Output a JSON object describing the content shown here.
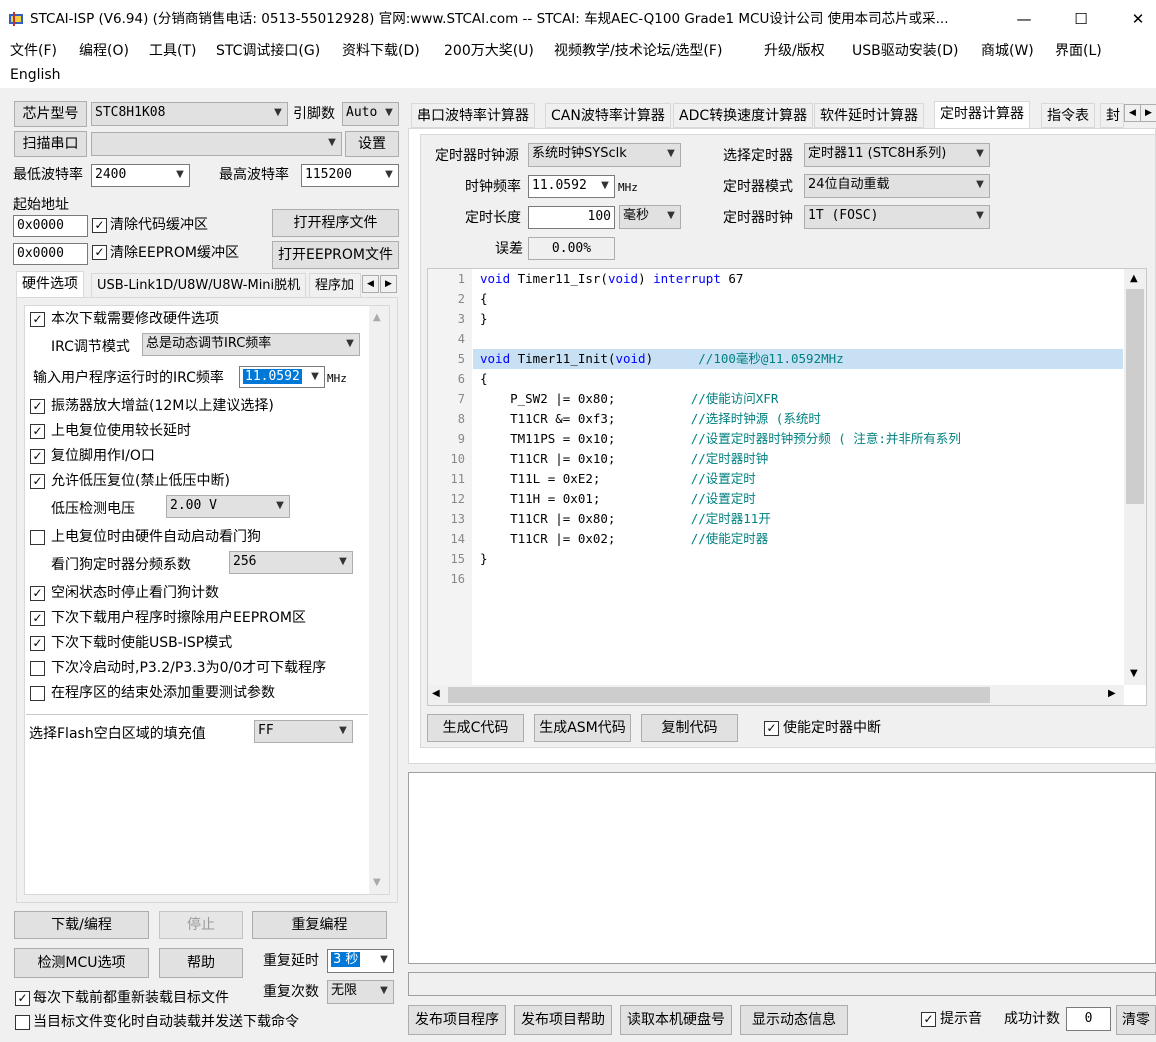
{
  "window": {
    "title": "STCAI-ISP (V6.94) (分销商销售电话: 0513-55012928) 官网:www.STCAI.com  -- STCAI: 车规AEC-Q100 Grade1 MCU设计公司 使用本司芯片或采...",
    "minimize": "—",
    "maximize": "☐",
    "close": "✕"
  },
  "menu": {
    "items": [
      "文件(F)",
      "编程(O)",
      "工具(T)",
      "STC调试接口(G)",
      "资料下载(D)",
      "200万大奖(U)",
      "视频教学/技术论坛/选型(F)",
      "升级/版权",
      "USB驱动安装(D)",
      "商城(W)",
      "界面(L)"
    ],
    "second_row": "English"
  },
  "left": {
    "chip_type_btn": "芯片型号",
    "chip_type_value": "STC8H1K08",
    "pin_label": "引脚数",
    "pin_value": "Auto",
    "scan_port_btn": "扫描串口",
    "port_value": "",
    "settings_btn": "设置",
    "min_baud_label": "最低波特率",
    "min_baud_value": "2400",
    "max_baud_label": "最高波特率",
    "max_baud_value": "115200",
    "start_addr_label": "起始地址",
    "addr1": "0x0000",
    "clear_code_label": "清除代码缓冲区",
    "open_prog_btn": "打开程序文件",
    "addr2": "0x0000",
    "clear_eeprom_label": "清除EEPROM缓冲区",
    "open_eeprom_btn": "打开EEPROM文件",
    "tabs": [
      "硬件选项",
      "USB-Link1D/U8W/U8W-Mini脱机",
      "程序加"
    ],
    "hw": {
      "need_modify": "本次下载需要修改硬件选项",
      "irc_mode_label": "IRC调节模式",
      "irc_mode_value": "总是动态调节IRC频率",
      "irc_freq_label": "输入用户程序运行时的IRC频率",
      "irc_freq_value": "11.0592",
      "irc_freq_unit": "MHz",
      "amp": "振荡器放大增益(12M以上建议选择)",
      "long_delay": "上电复位使用较长延时",
      "reset_io": "复位脚用作I/O口",
      "low_volt_reset": "允许低压复位(禁止低压中断)",
      "low_volt_label": "低压检测电压",
      "low_volt_value": "2.00 V",
      "watchdog": "上电复位时由硬件自动启动看门狗",
      "wd_div_label": "看门狗定时器分频系数",
      "wd_div_value": "256",
      "idle_stop_wd": "空闲状态时停止看门狗计数",
      "erase_eeprom": "下次下载用户程序时擦除用户EEPROM区",
      "usb_isp": "下次下载时使能USB-ISP模式",
      "cold_boot": "下次冷启动时,P3.2/P3.3为0/0才可下载程序",
      "add_params": "在程序区的结束处添加重要测试参数",
      "fill_label": "选择Flash空白区域的填充值",
      "fill_value": "FF"
    },
    "download_btn": "下载/编程",
    "stop_btn": "停止",
    "reprogram_btn": "重复编程",
    "detect_btn": "检测MCU选项",
    "help_btn": "帮助",
    "repeat_delay_label": "重复延时",
    "repeat_delay_value": "3 秒",
    "repeat_count_label": "重复次数",
    "repeat_count_value": "无限",
    "reload_label": "每次下载前都重新装载目标文件",
    "auto_load_label": "当目标文件变化时自动装载并发送下载命令"
  },
  "right": {
    "tabs": [
      "串口波特率计算器",
      "CAN波特率计算器",
      "ADC转换速度计算器",
      "软件延时计算器",
      "定时器计算器",
      "指令表",
      "封"
    ],
    "timer": {
      "clock_src_label": "定时器时钟源",
      "clock_src_value": "系统时钟SYSclk",
      "select_timer_label": "选择定时器",
      "select_timer_value": "定时器11 (STC8H系列)",
      "freq_label": "时钟频率",
      "freq_value": "11.0592",
      "freq_unit": "MHz",
      "mode_label": "定时器模式",
      "mode_value": "24位自动重载",
      "length_label": "定时长度",
      "length_value": "100",
      "length_unit": "毫秒",
      "timer_clock_label": "定时器时钟",
      "timer_clock_value": "1T  (FOSC)",
      "error_label": "误差",
      "error_value": "0.00%"
    },
    "code_lines": [
      {
        "n": "1"
      },
      {
        "n": "2"
      },
      {
        "n": "3"
      },
      {
        "n": "4"
      },
      {
        "n": "5"
      },
      {
        "n": "6"
      },
      {
        "n": "7"
      },
      {
        "n": "8"
      },
      {
        "n": "9"
      },
      {
        "n": "10"
      },
      {
        "n": "11"
      },
      {
        "n": "12"
      },
      {
        "n": "13"
      },
      {
        "n": "14"
      },
      {
        "n": "15"
      },
      {
        "n": "16"
      }
    ],
    "code": {
      "l1_kw": "void",
      "l1_a": " Timer11_Isr(",
      "l1_kw2": "void",
      "l1_b": ") ",
      "l1_kw3": "interrupt",
      "l1_c": " 67",
      "l2": "{",
      "l3": "}",
      "l5_kw": "void",
      "l5_a": " Timer11_Init(",
      "l5_kw2": "void",
      "l5_b": ")      ",
      "l5_cm": "//100毫秒@11.0592MHz",
      "l6": "{",
      "l7": "    P_SW2 |= 0x80;          ",
      "l7_cm": "//使能访问XFR",
      "l8": "    T11CR &= 0xf3;          ",
      "l8_cm": "//选择时钟源 (系统时",
      "l9": "    TM11PS = 0x10;          ",
      "l9_cm": "//设置定时器时钟预分频 ( 注意:并非所有系列",
      "l10": "    T11CR |= 0x10;          ",
      "l10_cm": "//定时器时钟",
      "l11": "    T11L = 0xE2;            ",
      "l11_cm": "//设置定时",
      "l12": "    T11H = 0x01;            ",
      "l12_cm": "//设置定时",
      "l13": "    T11CR |= 0x80;          ",
      "l13_cm": "//定时器11开",
      "l14": "    T11CR |= 0x02;          ",
      "l14_cm": "//使能定时器",
      "l15": "}"
    },
    "gen_c_btn": "生成C代码",
    "gen_asm_btn": "生成ASM代码",
    "copy_btn": "复制代码",
    "enable_int_label": "使能定时器中断",
    "bottom": {
      "publish_prog_btn": "发布项目程序",
      "publish_help_btn": "发布项目帮助",
      "read_disk_btn": "读取本机硬盘号",
      "show_dynamic_btn": "显示动态信息",
      "beep_label": "提示音",
      "success_count_label": "成功计数",
      "success_count_value": "0",
      "clear_btn": "清零"
    }
  }
}
